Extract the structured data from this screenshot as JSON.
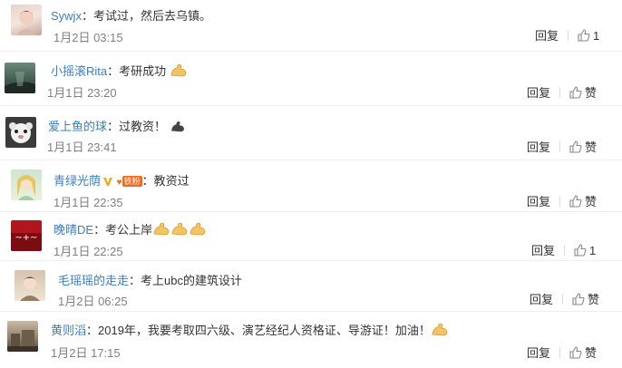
{
  "comments": [
    {
      "username": "Sywjx",
      "text": "：考试过，然后去乌镇。",
      "date": "1月2日 03:15",
      "reply": "回复",
      "like": "1"
    },
    {
      "username": "小摇滚Rita",
      "text": "：考研成功",
      "date": "1月1日 23:20",
      "reply": "回复",
      "like": "赞"
    },
    {
      "username": "爱上鱼的球",
      "text": "：过教资！",
      "date": "1月1日 23:41",
      "reply": "回复",
      "like": "赞"
    },
    {
      "username": "青绿光荫",
      "badge": "铁粉",
      "text": "：教资过",
      "date": "1月1日 22:35",
      "reply": "回复",
      "like": "赞"
    },
    {
      "username": "晚晴DE",
      "text": "：考公上岸",
      "date": "1月1日 22:25",
      "reply": "回复",
      "like": "1"
    },
    {
      "username": "毛瑶瑶的走走",
      "text": "：考上ubc的建筑设计",
      "date": "1月2日 06:25",
      "reply": "回复",
      "like": "赞"
    },
    {
      "username": "黄则滔",
      "text": "：2019年，我要考取四六级、演艺经纪人资格证、导游证！加油！",
      "date": "1月2日 17:15",
      "reply": "回复",
      "like": "赞"
    }
  ],
  "colors": {
    "username": "#3a7fbf",
    "date": "#808080",
    "text": "#333333",
    "badge": "#f66a1a"
  },
  "icons": [
    "thumbs-up-icon",
    "flexed-biceps-icon",
    "vip-v-icon"
  ]
}
